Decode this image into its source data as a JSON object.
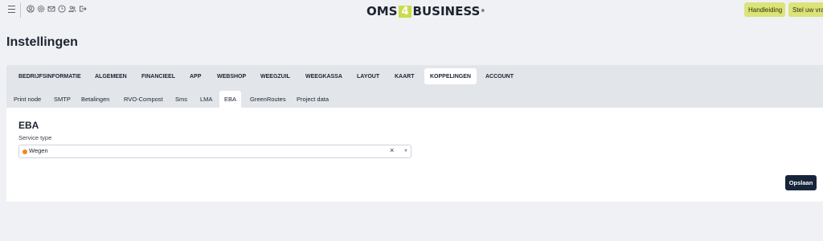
{
  "header": {
    "logo_left": "OMS",
    "logo_number": "4",
    "logo_right": "BUSINESS",
    "logo_mark": "®",
    "toolbar_icons": [
      "user-circle-icon",
      "gear-icon",
      "mail-icon",
      "clock-icon",
      "users-icon",
      "logout-icon"
    ],
    "manual_label": "Handleiding",
    "ask_label": "Stel uw vraag"
  },
  "page": {
    "title": "Instellingen"
  },
  "main_tabs": [
    {
      "label": "BEDRIJFSINFORMATIE"
    },
    {
      "label": "ALGEMEEN"
    },
    {
      "label": "FINANCIEEL"
    },
    {
      "label": "APP"
    },
    {
      "label": "WEBSHOP"
    },
    {
      "label": "WEEGZUIL"
    },
    {
      "label": "WEEGKASSA"
    },
    {
      "label": "LAYOUT"
    },
    {
      "label": "KAART"
    },
    {
      "label": "KOPPELINGEN",
      "active": true
    },
    {
      "label": "ACCOUNT"
    }
  ],
  "sub_tabs": [
    {
      "label": "Print node"
    },
    {
      "label": "SMTP"
    },
    {
      "label": "Betalingen"
    },
    {
      "label": "RVO-Compost"
    },
    {
      "label": "Sms"
    },
    {
      "label": "LMA"
    },
    {
      "label": "EBA",
      "active": true
    },
    {
      "label": "GreenRoutes"
    },
    {
      "label": "Project data"
    }
  ],
  "eba": {
    "title": "EBA",
    "service_type_label": "Service type",
    "service_type_value": "Wegen",
    "clear_symbol": "×",
    "save_label": "Opslaan"
  },
  "colors": {
    "accent": "#dbe37a",
    "logo_green": "#c9dc4a",
    "primary_dark": "#16253a",
    "status_dot": "#f2871e",
    "background": "#f0f1f4"
  }
}
